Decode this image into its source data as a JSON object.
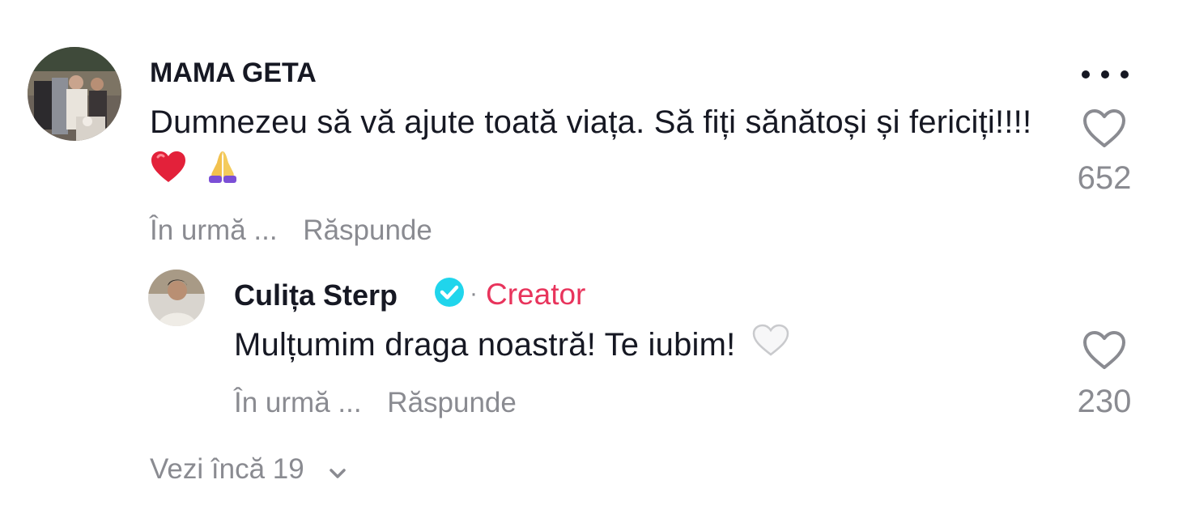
{
  "comment": {
    "username": "MAMA GETA",
    "text": "Dumnezeu să vă ajute toată viața. Să fiți sănătoși și fericiți!!!!",
    "emojis": [
      "red-heart",
      "folded-hands"
    ],
    "time": "În urmă ...",
    "reply_label": "Răspunde",
    "likes": "652",
    "more_icon": "ellipsis-icon",
    "like_icon": "heart-outline-icon"
  },
  "reply": {
    "username": "Culița Sterp",
    "verified_icon": "verified-badge-icon",
    "separator": "·",
    "creator_label": "Creator",
    "text": "Mulțumim draga noastră! Te iubim!",
    "emoji": "white-heart",
    "time": "În urmă ...",
    "reply_label": "Răspunde",
    "likes": "230",
    "like_icon": "heart-outline-icon"
  },
  "view_more": {
    "label": "Vezi încă 19",
    "icon": "chevron-down-icon"
  },
  "colors": {
    "text_primary": "#161823",
    "text_secondary": "#8a8b91",
    "creator_accent": "#e8345c",
    "verified_blue": "#20d5ec"
  }
}
